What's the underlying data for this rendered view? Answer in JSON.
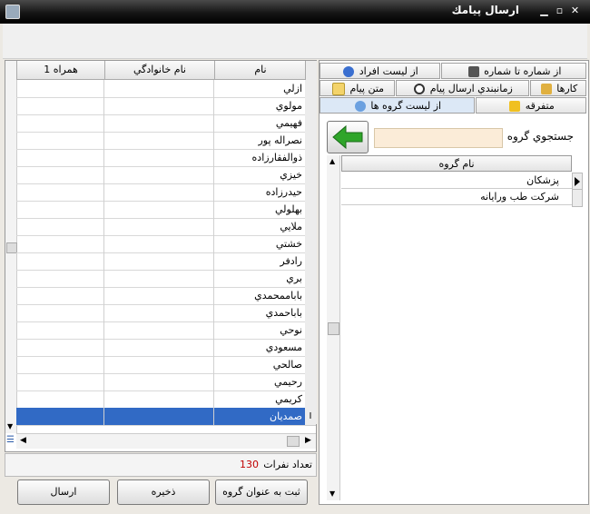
{
  "window": {
    "title": "ارسال پیامك"
  },
  "left_grid": {
    "columns": [
      "همراه 1",
      "نام خانوادگي",
      "نام"
    ],
    "rows": [
      {
        "name": "ازلي"
      },
      {
        "name": "مولوي"
      },
      {
        "name": "فهيمي"
      },
      {
        "name": "نصراله پور"
      },
      {
        "name": "ذوالفقارزاده"
      },
      {
        "name": "خيزي"
      },
      {
        "name": "حيدرزاده"
      },
      {
        "name": "بهلولي"
      },
      {
        "name": "ملايي"
      },
      {
        "name": "خشتي"
      },
      {
        "name": "رادفر"
      },
      {
        "name": "بري"
      },
      {
        "name": "باباممحمدي"
      },
      {
        "name": "باباحمدي"
      },
      {
        "name": "نوحي"
      },
      {
        "name": "مسعودي"
      },
      {
        "name": "صالحي"
      },
      {
        "name": "رحيمي"
      },
      {
        "name": "كريمي"
      },
      {
        "name": "صمديان",
        "selected": true
      }
    ]
  },
  "count": {
    "label": "تعداد نفرات",
    "value": "130"
  },
  "buttons": {
    "save_group": "ثبت به عنوان گروه",
    "save": "ذخيره",
    "send": "ارسال"
  },
  "tabs": [
    {
      "label": "از شماره تا شماره",
      "icon": "lock-icon",
      "row": 1
    },
    {
      "label": "از ليست افراد",
      "icon": "user-icon",
      "row": 1
    },
    {
      "label": "كارها",
      "icon": "pencil-icon",
      "row": 2
    },
    {
      "label": "زمانبندي ارسال پيام",
      "icon": "clock-icon",
      "row": 2
    },
    {
      "label": "متن پيام",
      "icon": "envelope-icon",
      "row": 2
    },
    {
      "label": "متفرقه",
      "icon": "star-icon",
      "row": 3
    },
    {
      "label": "از ليست گروه ها",
      "icon": "group-icon",
      "row": 3,
      "active": true
    }
  ],
  "group_search": {
    "label": "جستجوي گروه",
    "value": ""
  },
  "group_grid": {
    "header": "نام گروه",
    "rows": [
      "پزشكان",
      "شركت طب ورايانه"
    ]
  },
  "colors": {
    "selection": "#316ac5",
    "count_value": "#c00000",
    "search_bg": "#fbecd8"
  }
}
